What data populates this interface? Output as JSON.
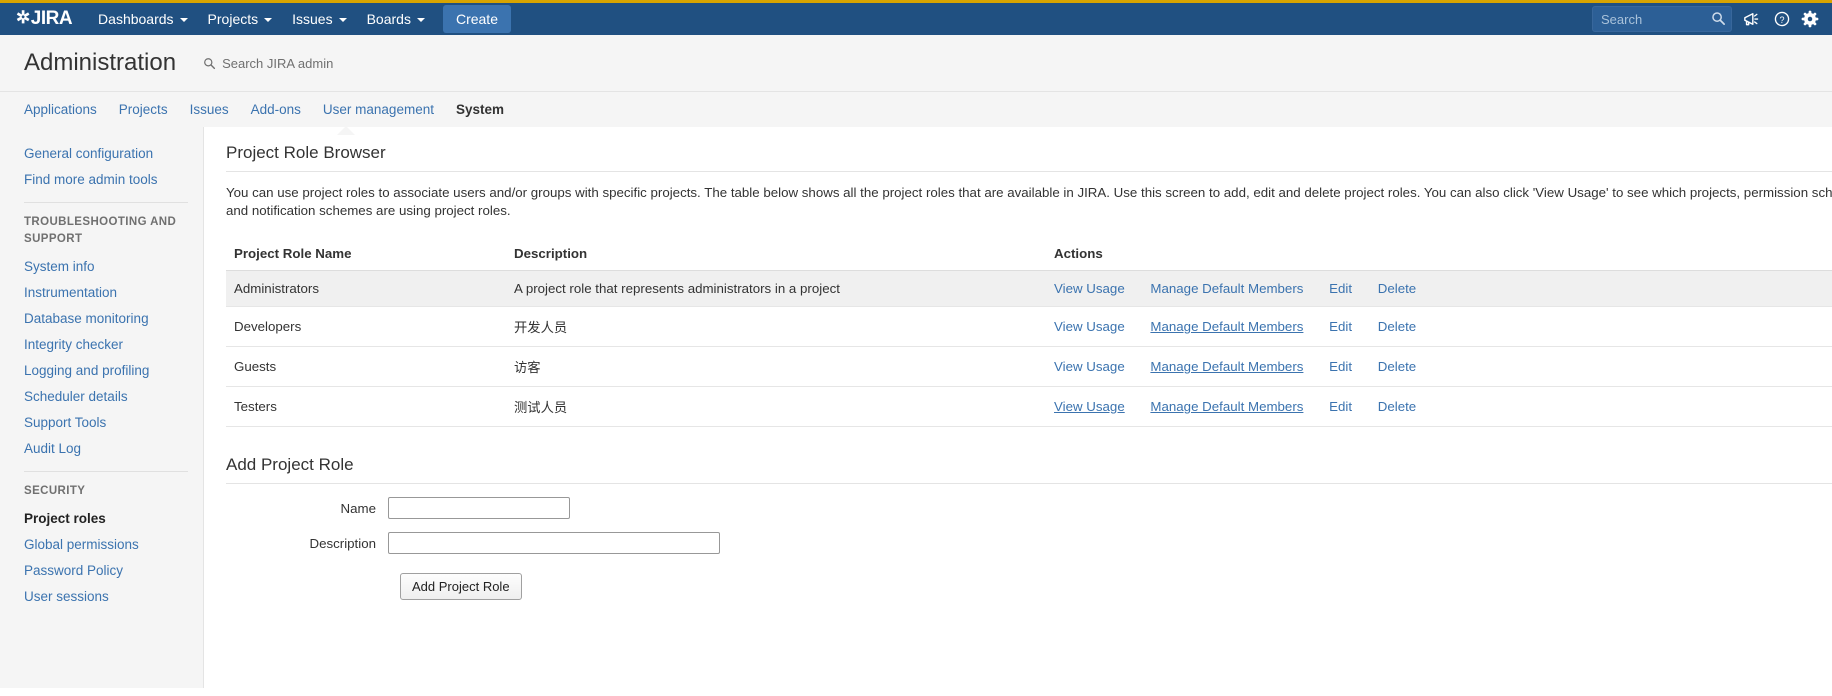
{
  "topnav": {
    "logo_text": "JIRA",
    "items": [
      {
        "label": "Dashboards",
        "has_caret": true
      },
      {
        "label": "Projects",
        "has_caret": true
      },
      {
        "label": "Issues",
        "has_caret": true
      },
      {
        "label": "Boards",
        "has_caret": true
      }
    ],
    "create_label": "Create",
    "search_placeholder": "Search",
    "icons": {
      "search": "search-icon",
      "announcement": "megaphone-icon",
      "help": "help-circle-icon",
      "settings": "gear-icon"
    }
  },
  "admin_header": {
    "title": "Administration",
    "search_placeholder": "Search JIRA admin",
    "search_icon": "search-icon"
  },
  "admin_tabs": [
    {
      "label": "Applications",
      "active": false
    },
    {
      "label": "Projects",
      "active": false
    },
    {
      "label": "Issues",
      "active": false
    },
    {
      "label": "Add-ons",
      "active": false
    },
    {
      "label": "User management",
      "active": false
    },
    {
      "label": "System",
      "active": true
    }
  ],
  "sidebar": {
    "top_items": [
      {
        "label": "General configuration"
      },
      {
        "label": "Find more admin tools"
      }
    ],
    "group_troubleshooting": {
      "heading": "TROUBLESHOOTING AND SUPPORT",
      "items": [
        {
          "label": "System info"
        },
        {
          "label": "Instrumentation"
        },
        {
          "label": "Database monitoring"
        },
        {
          "label": "Integrity checker"
        },
        {
          "label": "Logging and profiling"
        },
        {
          "label": "Scheduler details"
        },
        {
          "label": "Support Tools"
        },
        {
          "label": "Audit Log"
        }
      ]
    },
    "group_security": {
      "heading": "SECURITY",
      "items": [
        {
          "label": "Project roles",
          "active": true
        },
        {
          "label": "Global permissions",
          "active": false
        },
        {
          "label": "Password Policy",
          "active": false
        },
        {
          "label": "User sessions",
          "active": false
        }
      ]
    }
  },
  "main": {
    "page_title": "Project Role Browser",
    "description_line1": "You can use project roles to associate users and/or groups with specific projects. The table below shows all the project roles that are available in JIRA. Use this screen to add, edit and delete project roles. You can also click 'View Usage' to see which projects, permission sch",
    "description_line2": "and notification schemes are using project roles.",
    "table": {
      "headers": {
        "name": "Project Role Name",
        "description": "Description",
        "actions": "Actions"
      },
      "rows": [
        {
          "name": "Administrators",
          "description": "A project role that represents administrators in a project",
          "actions": [
            {
              "label": "View Usage",
              "underlined": false
            },
            {
              "label": "Manage Default Members",
              "underlined": false
            },
            {
              "label": "Edit",
              "underlined": false
            },
            {
              "label": "Delete",
              "underlined": false
            }
          ]
        },
        {
          "name": "Developers",
          "description": "开发人员",
          "actions": [
            {
              "label": "View Usage",
              "underlined": false
            },
            {
              "label": "Manage Default Members",
              "underlined": true
            },
            {
              "label": "Edit",
              "underlined": false
            },
            {
              "label": "Delete",
              "underlined": false
            }
          ]
        },
        {
          "name": "Guests",
          "description": "访客",
          "actions": [
            {
              "label": "View Usage",
              "underlined": false
            },
            {
              "label": "Manage Default Members",
              "underlined": true
            },
            {
              "label": "Edit",
              "underlined": false
            },
            {
              "label": "Delete",
              "underlined": false
            }
          ]
        },
        {
          "name": "Testers",
          "description": "测试人员",
          "actions": [
            {
              "label": "View Usage",
              "underlined": true
            },
            {
              "label": "Manage Default Members",
              "underlined": true
            },
            {
              "label": "Edit",
              "underlined": false
            },
            {
              "label": "Delete",
              "underlined": false
            }
          ]
        }
      ]
    },
    "add_form": {
      "title": "Add Project Role",
      "name_label": "Name",
      "name_value": "",
      "description_label": "Description",
      "description_value": "",
      "submit_label": "Add Project Role"
    }
  },
  "colors": {
    "brand_blue": "#205081",
    "accent_gold": "#d8a400",
    "link_blue": "#3b73af",
    "create_button": "#3b73af",
    "row_alt": "#f0f0f0",
    "panel_grey": "#f5f5f5"
  }
}
